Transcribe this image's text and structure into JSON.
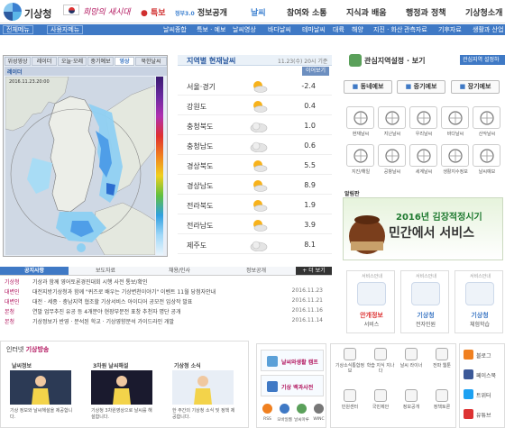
{
  "header": {
    "logo_text": "기상청",
    "slogan": "희망의 새시대",
    "nav": [
      "특보",
      "정보공개",
      "날씨",
      "참여와 소통",
      "지식과 배움",
      "행정과 정책",
      "기상청소개"
    ],
    "gov3": "정부3.0",
    "active_nav": "날씨"
  },
  "subnav": {
    "left_boxes": [
      "전체메뉴",
      "사용자메뉴"
    ],
    "items": [
      "날씨종합",
      "특보 · 예보",
      "날씨영상",
      "바다날씨",
      "테마날씨",
      "대륙",
      "해양",
      "지진 · 화산",
      "관측자료",
      "기후자료",
      "생활과 산업"
    ]
  },
  "radar": {
    "tabs": [
      "위성영상",
      "레이더",
      "오늘·모레",
      "중기예보",
      "영상",
      "북한날씨"
    ],
    "active_tab": "영상",
    "bar_label": "레이더",
    "timestamp": "2016.11.23.20:00"
  },
  "current_weather": {
    "title": "지역별 현재날씨",
    "time": "11.23(수) 20시 기준",
    "badge": "이어보기",
    "rows": [
      {
        "city": "서울·경기",
        "icon": "sun-cloud-icon",
        "temp": "-2.4"
      },
      {
        "city": "강원도",
        "icon": "sun-cloud-icon",
        "temp": "0.4"
      },
      {
        "city": "충청북도",
        "icon": "cloud-icon",
        "temp": "1.0"
      },
      {
        "city": "충청남도",
        "icon": "cloud-icon",
        "temp": "0.6"
      },
      {
        "city": "경상북도",
        "icon": "sun-cloud-icon",
        "temp": "5.5"
      },
      {
        "city": "경상남도",
        "icon": "sun-cloud-icon",
        "temp": "8.9"
      },
      {
        "city": "전라북도",
        "icon": "sun-cloud-icon",
        "temp": "1.9"
      },
      {
        "city": "전라남도",
        "icon": "sun-cloud-icon",
        "temp": "3.9"
      },
      {
        "city": "제주도",
        "icon": "cloud-icon",
        "temp": "8.1"
      }
    ]
  },
  "region_setting": {
    "title": "관심지역설정 · 보기",
    "button": "관심지역 설정하기",
    "forecast_buttons": [
      "동네예보",
      "중기예보",
      "장기예보"
    ],
    "tiles": [
      "현재날씨",
      "지난날씨",
      "우리날씨",
      "바다날씨",
      "산악날씨",
      "지진/해일",
      "공항날씨",
      "세계날씨",
      "생활지수정보",
      "날씨예보"
    ]
  },
  "banner": {
    "tag": "알림판",
    "line1": "2016년 김장적정시기",
    "line2": "민간에서 서비스"
  },
  "guides": [
    {
      "label": "안개정보",
      "sub": "서비스",
      "tag": "서비스안내"
    },
    {
      "label": "기상청",
      "sub": "전자민원",
      "tag": "서비스안내"
    },
    {
      "label": "기상청",
      "sub": "체험학습",
      "tag": "서비스안내"
    }
  ],
  "notice": {
    "tabs": [
      "공지사항",
      "보도자료",
      "채용/인사",
      "정보공개"
    ],
    "more": "+ 더 보기",
    "rows": [
      {
        "cat": "기상청",
        "title": "기상과 함께 영어토론경진대회 시행 사전 통보/확인",
        "date": ""
      },
      {
        "cat": "대변인",
        "title": "대전지방기상청과 함께 \"퀴즈로 배우는 기상변천이야기\" 이벤트 11월 당첨자안내",
        "date": "2016.11.23"
      },
      {
        "cat": "대변인",
        "title": "대전 · 세종 · 충남지역 협조할 기상서비스 아이디어 공모전 입상작 발표",
        "date": "2016.11.21"
      },
      {
        "cat": "본청",
        "title": "연말 업무추진 유공 등 4개분야 현장부문전 표창 추천자 명단 공개",
        "date": "2016.11.16"
      },
      {
        "cat": "본청",
        "title": "기상정보가 반영 · 분석된 학교 · 기상영향분석 가이드라인 개발",
        "date": "2016.11.14"
      }
    ]
  },
  "broadcast": {
    "title_prefix": "인터넷",
    "title_highlight": "기상방송",
    "videos": [
      {
        "label": "날씨정보",
        "caption": "기상 정보와 날씨해설을 제공합니다."
      },
      {
        "label": "3차원 날씨해설",
        "caption": "기상청 3차원영상으로 날씨를 해설합니다."
      },
      {
        "label": "기상청 소식",
        "caption": "한 주간의 기상청 소식 및 정책 제공합니다."
      }
    ]
  },
  "quick_links": {
    "top": "날씨와생활 캠프",
    "bottom": "기상 백과사전",
    "icons": [
      "RSS",
      "모바일웹",
      "날씨마루",
      "WINC"
    ]
  },
  "services": {
    "row1": [
      "기상소식통합정보",
      "학습 지식 지나다",
      "날씨 라이너",
      "전파 웹툰"
    ],
    "row2": [
      "민원센터",
      "국민제안",
      "정보공개",
      "정책토론"
    ]
  },
  "social": [
    "블로그",
    "페이스북",
    "트위터",
    "유튜브"
  ],
  "colors": {
    "primary_blue": "#3f79c5",
    "accent_magenta": "#b2155e",
    "banner_green": "#2e8b3a"
  }
}
